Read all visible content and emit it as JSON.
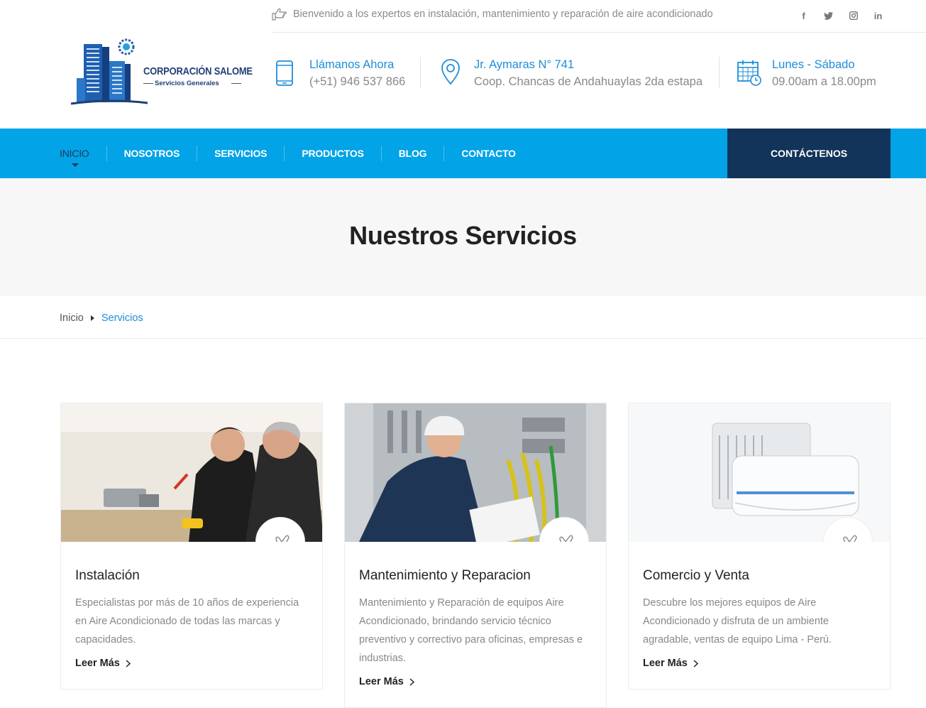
{
  "topbar": {
    "welcome": "Bienvenido a los expertos en instalación, mantenimiento y reparación de aire acondicionado",
    "social": [
      "facebook-icon",
      "twitter-icon",
      "instagram-icon",
      "linkedin-icon"
    ]
  },
  "logo": {
    "name": "CORPORACIÓN SALOME",
    "sub": "Servicios Generales"
  },
  "info": [
    {
      "line1": "Llámanos Ahora",
      "line2": "(+51) 946 537 866",
      "icon": "phone-icon"
    },
    {
      "line1": "Jr. Aymaras N° 741",
      "line2": "Coop. Chancas de Andahuaylas 2da estapa",
      "icon": "location-pin-icon"
    },
    {
      "line1": "Lunes - Sábado",
      "line2": "09.00am a 18.00pm",
      "icon": "calendar-icon"
    }
  ],
  "nav": {
    "items": [
      "INICIO",
      "NOSOTROS",
      "SERVICIOS",
      "PRODUCTOS",
      "BLOG",
      "CONTACTO"
    ],
    "active": "INICIO",
    "cta": "CONTÁCTENOS"
  },
  "page": {
    "title": "Nuestros Servicios"
  },
  "breadcrumb": {
    "home": "Inicio",
    "current": "Servicios"
  },
  "cards": [
    {
      "title": "Instalación",
      "text": "Especialistas por más de 10 años de experiencia en Aire Acondicionado de todas las marcas y capacidades.",
      "more": "Leer Más"
    },
    {
      "title": "Mantenimiento y Reparacion",
      "text": "Mantenimiento y Reparación de equipos Aire Acondicionado, brindando servicio técnico preventivo y correctivo para oficinas, empresas e industrias.",
      "more": "Leer Más"
    },
    {
      "title": "Comercio y Venta",
      "text": "Descubre los mejores equipos de Aire Acondicionado y disfruta de un ambiente agradable, ventas de equipo Lima - Perú.",
      "more": "Leer Más"
    }
  ],
  "colors": {
    "accent": "#02a3e7",
    "dark": "#13345a",
    "link": "#1e8ed8"
  }
}
